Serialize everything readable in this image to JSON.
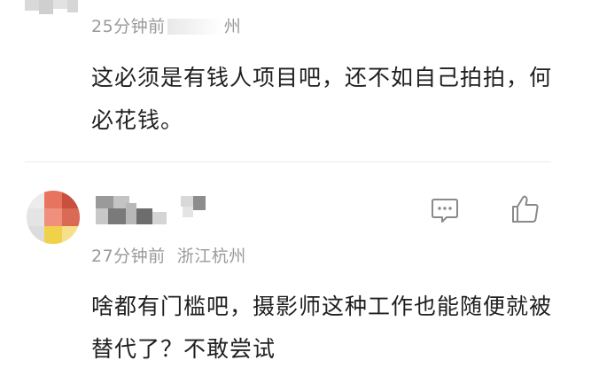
{
  "comments": [
    {
      "time": "25分钟前",
      "location_partial": "州",
      "text": "这必须是有钱人项目吧，还不如自己拍拍，何必花钱。"
    },
    {
      "time": "27分钟前",
      "location": "浙江杭州",
      "text": "啥都有门槛吧，摄影师这种工作也能随便就被替代了？不敢尝试",
      "actions": {
        "reply_icon": "comment-bubble-icon",
        "like_icon": "thumbs-up-icon"
      }
    }
  ],
  "colors": {
    "text": "#1f1f1f",
    "meta": "#9a9a9a",
    "divider": "#ececec",
    "icon": "#8a8a8a"
  }
}
